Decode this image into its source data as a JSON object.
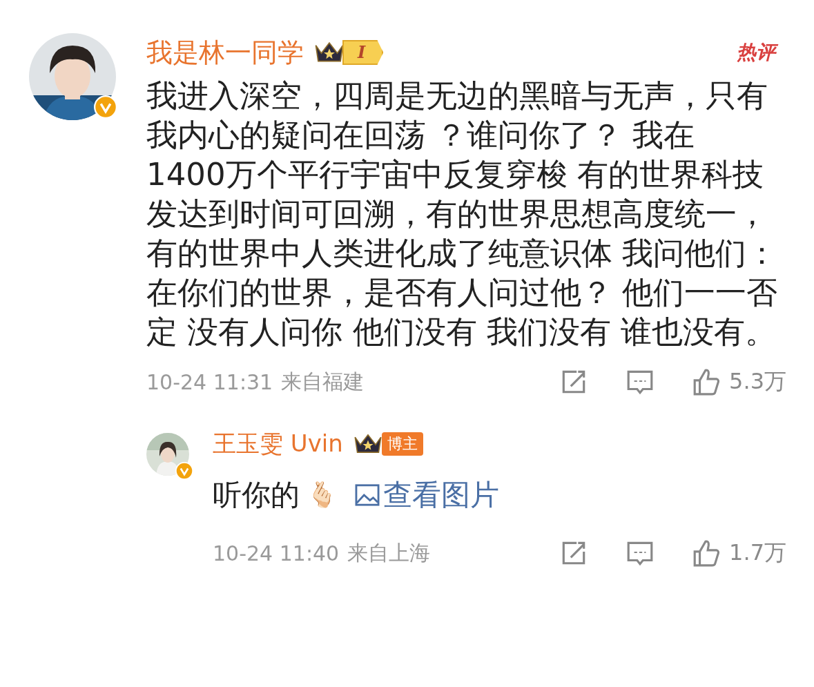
{
  "comment": {
    "author": "我是林一同学",
    "level_badge": "I",
    "hot_label": "热评",
    "verified": true,
    "text": "我进入深空，四周是无边的黑暗与无声，只有我内心的疑问在回荡 ？谁问你了？ 我在 1400万个平行宇宙中反复穿梭 有的世界科技发达到时间可回溯，有的世界思想高度统一，有的世界中人类进化成了纯意识体 我问他们：在你们的世界，是否有人问过他？ 他们一一否定 没有人问你 他们没有 我们没有 谁也没有。",
    "time": "10-24 11:31",
    "location": "来自福建",
    "likes": "5.3万",
    "reply": {
      "author": "王玉雯 Uvin",
      "role_badge": "博主",
      "verified": true,
      "text": "听你的",
      "emoji": "🫰🏻",
      "image_link": "查看图片",
      "time": "10-24 11:40",
      "location": "来自上海",
      "likes": "1.7万"
    }
  }
}
